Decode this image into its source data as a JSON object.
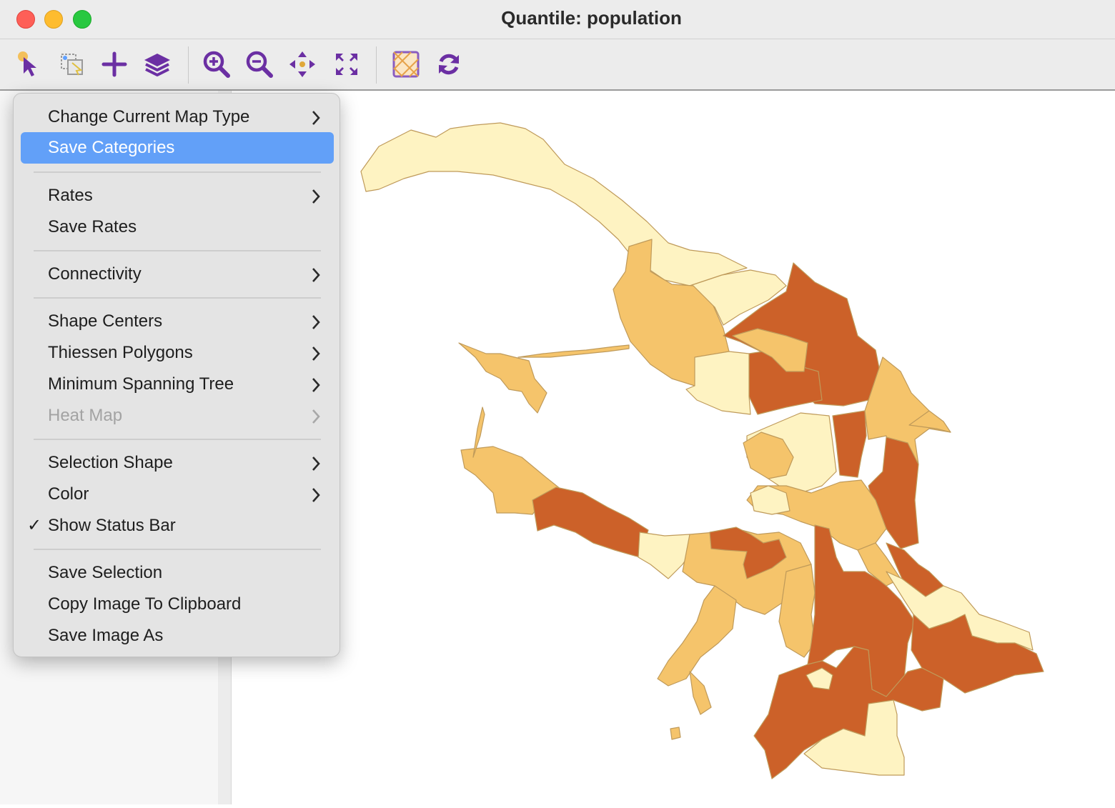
{
  "window": {
    "title": "Quantile: population"
  },
  "toolbar": {
    "buttons": [
      {
        "name": "select-icon"
      },
      {
        "name": "select-by-rectangle-icon"
      },
      {
        "name": "add-layer-icon"
      },
      {
        "name": "layers-icon"
      },
      {
        "name": "zoom-in-icon"
      },
      {
        "name": "zoom-out-icon"
      },
      {
        "name": "pan-icon"
      },
      {
        "name": "fit-to-window-icon"
      },
      {
        "name": "basemap-icon"
      },
      {
        "name": "refresh-icon"
      }
    ]
  },
  "context_menu": {
    "items": [
      {
        "label": "Change Current Map Type",
        "submenu": true
      },
      {
        "label": "Save Categories",
        "highlighted": true
      },
      {
        "label": "Rates",
        "submenu": true
      },
      {
        "label": "Save Rates"
      },
      {
        "label": "Connectivity",
        "submenu": true
      },
      {
        "label": "Shape Centers",
        "submenu": true
      },
      {
        "label": "Thiessen Polygons",
        "submenu": true
      },
      {
        "label": "Minimum Spanning Tree",
        "submenu": true
      },
      {
        "label": "Heat Map",
        "submenu": true,
        "disabled": true
      },
      {
        "label": "Selection Shape",
        "submenu": true
      },
      {
        "label": "Color",
        "submenu": true
      },
      {
        "label": "Show Status Bar",
        "checked": true
      },
      {
        "label": "Save Selection"
      },
      {
        "label": "Copy Image To Clipboard"
      },
      {
        "label": "Save Image As"
      }
    ]
  },
  "map": {
    "classes": [
      {
        "color": "#fef3c2"
      },
      {
        "color": "#f5c46b"
      },
      {
        "color": "#cc6129"
      }
    ],
    "outline_color": "#bf9a5a"
  }
}
